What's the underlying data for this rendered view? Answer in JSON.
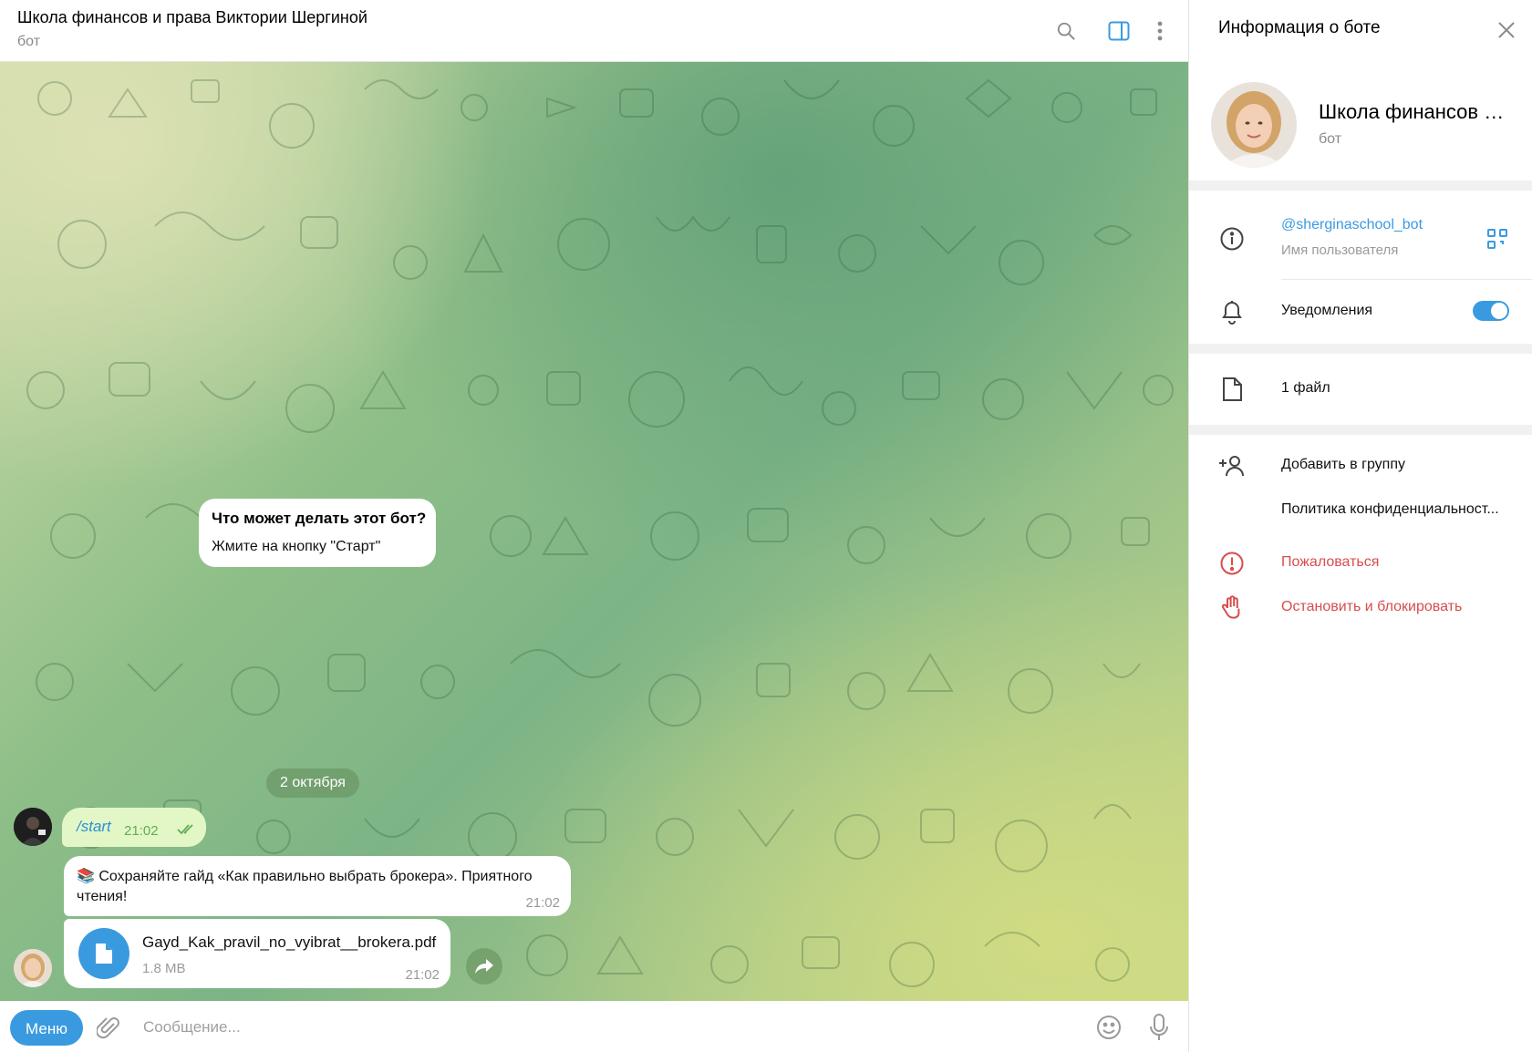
{
  "chat": {
    "title": "Школа финансов и права Виктории Шергиной",
    "subtitle": "бот",
    "bot_info_title": "Что может делать этот бот?",
    "bot_info_text": "Жмите на кнопку \"Старт\"",
    "date_separator": "2 октября",
    "messages": [
      {
        "from": "user",
        "text": "/start",
        "time": "21:02",
        "status": "read"
      },
      {
        "from": "bot",
        "emoji": "📚",
        "text": "Сохраняйте гайд «Как правильно выбрать брокера». Приятного чтения!",
        "time": "21:02"
      },
      {
        "from": "bot",
        "file_name": "Gayd_Kak_pravil_no_vyibrat__brokera.pdf",
        "file_size": "1.8 MB",
        "time": "21:02"
      }
    ]
  },
  "header_icons": [
    "search-icon",
    "sidebar-toggle-icon",
    "more-vertical-icon"
  ],
  "input": {
    "menu_label": "Меню",
    "placeholder": "Сообщение..."
  },
  "panel": {
    "title": "Информация о боте",
    "name": "Школа финансов и права Виктории Шергиной",
    "subtitle": "бот",
    "username": "@sherginaschool_bot",
    "username_caption": "Имя пользователя",
    "notifications_label": "Уведомления",
    "notifications_on": true,
    "files_label": "1 файл",
    "add_to_group": "Добавить в группу",
    "privacy": "Политика конфиденциальност...",
    "report": "Пожаловаться",
    "block": "Остановить и блокировать"
  },
  "colors": {
    "accent": "#3a9ae0",
    "danger": "#d84d4d",
    "outgoing_bubble": "#e3f7c6",
    "read_check": "#5fae54"
  }
}
